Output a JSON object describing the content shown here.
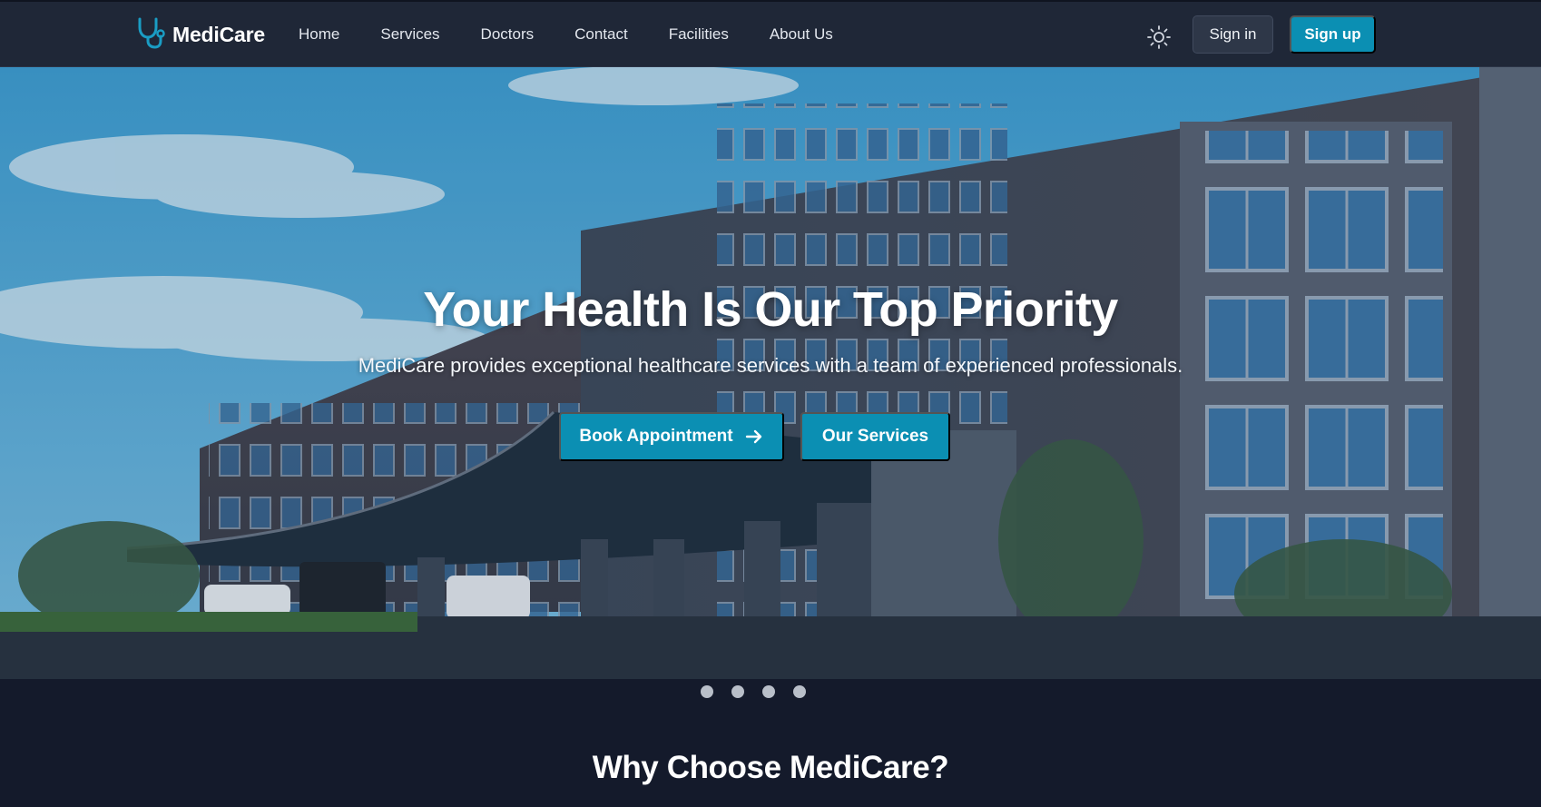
{
  "brand": {
    "name": "MediCare",
    "icon": "stethoscope-icon",
    "accent": "#0b8fb3"
  },
  "nav": {
    "links": [
      "Home",
      "Services",
      "Doctors",
      "Contact",
      "Facilities",
      "About Us"
    ],
    "theme_icon": "sun-icon",
    "sign_in": "Sign in",
    "sign_up": "Sign up"
  },
  "hero": {
    "title": "Your Health Is Our Top Priority",
    "subtitle": "MediCare provides exceptional healthcare services with a team of experienced professionals.",
    "primary_cta": "Book Appointment",
    "secondary_cta": "Our Services",
    "slide_count": 4,
    "background": "hospital-building-photo"
  },
  "section": {
    "title": "Why Choose MediCare?"
  },
  "colors": {
    "nav_bg": "#1f2737",
    "page_bg": "#141a2b",
    "button": "#0b8fb3"
  }
}
